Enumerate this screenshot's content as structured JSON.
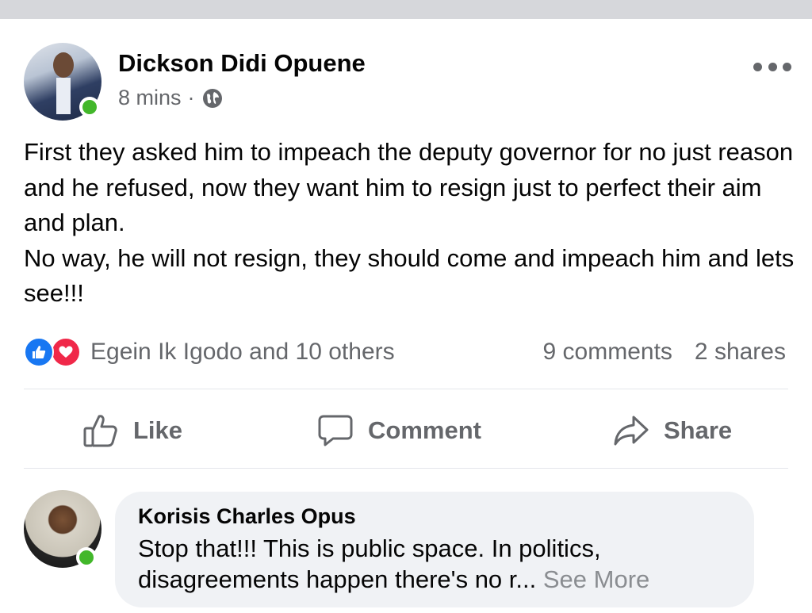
{
  "post": {
    "author": "Dickson Didi Opuene",
    "time": "8 mins",
    "separator": "·",
    "privacy_icon": "globe-icon",
    "text_lines": [
      "First they asked him to impeach the deputy governor for no just reason and he refused, now they want him to resign just to perfect their aim and plan.",
      "No way, he will not resign, they should come and impeach him and lets see!!!"
    ],
    "reactions": {
      "icons": [
        "like-reaction-icon",
        "love-reaction-icon"
      ],
      "summary": "Egein Ik Igodo and 10 others"
    },
    "comments_count": "9 comments",
    "shares_count": "2 shares",
    "actions": {
      "like": "Like",
      "comment": "Comment",
      "share": "Share"
    }
  },
  "comment": {
    "author": "Korisis Charles Opus",
    "line1": "Stop that!!! This is public space. In politics,",
    "line2": "disagreements happen there's no r...",
    "see_more": "See More"
  },
  "colors": {
    "like_blue": "#1877f2",
    "love_red": "#f02849",
    "online_green": "#42b72a",
    "secondary_text": "#65676b",
    "bubble_bg": "#f0f2f5"
  }
}
